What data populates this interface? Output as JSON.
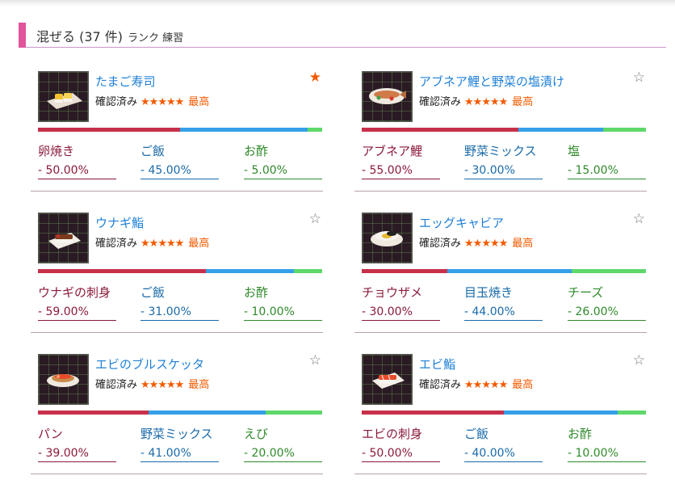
{
  "header": {
    "title": "混ぜる (37 件)",
    "subtitle": "ランク 練習"
  },
  "colors": {
    "accent": "#e0559b",
    "link": "#1e7fd6",
    "star": "#f25a00",
    "bar1": "#c8304a",
    "bar2": "#35a0e8",
    "bar3": "#5fd86a"
  },
  "recipes": [
    {
      "name": "たまご寿司",
      "status": "確認済み",
      "stars": "★★★★★",
      "grade": "最高",
      "favorite": true,
      "fav_icon": "★",
      "ingredients": [
        {
          "name": "卵焼き",
          "pct": "- 50.00%",
          "share": 50
        },
        {
          "name": "ご飯",
          "pct": "- 45.00%",
          "share": 45
        },
        {
          "name": "お酢",
          "pct": "- 5.00%",
          "share": 5
        }
      ]
    },
    {
      "name": "アブネア鯉と野菜の塩漬け",
      "status": "確認済み",
      "stars": "★★★★★",
      "grade": "最高",
      "favorite": false,
      "fav_icon": "☆",
      "ingredients": [
        {
          "name": "アブネア鯉",
          "pct": "- 55.00%",
          "share": 55
        },
        {
          "name": "野菜ミックス",
          "pct": "- 30.00%",
          "share": 30
        },
        {
          "name": "塩",
          "pct": "- 15.00%",
          "share": 15
        }
      ]
    },
    {
      "name": "ウナギ鮨",
      "status": "確認済み",
      "stars": "★★★★★",
      "grade": "最高",
      "favorite": false,
      "fav_icon": "☆",
      "ingredients": [
        {
          "name": "ウナギの刺身",
          "pct": "- 59.00%",
          "share": 59
        },
        {
          "name": "ご飯",
          "pct": "- 31.00%",
          "share": 31
        },
        {
          "name": "お酢",
          "pct": "- 10.00%",
          "share": 10
        }
      ]
    },
    {
      "name": "エッグキャビア",
      "status": "確認済み",
      "stars": "★★★★★",
      "grade": "最高",
      "favorite": false,
      "fav_icon": "☆",
      "ingredients": [
        {
          "name": "チョウザメ",
          "pct": "- 30.00%",
          "share": 30
        },
        {
          "name": "目玉焼き",
          "pct": "- 44.00%",
          "share": 44
        },
        {
          "name": "チーズ",
          "pct": "- 26.00%",
          "share": 26
        }
      ]
    },
    {
      "name": "エビのブルスケッタ",
      "status": "確認済み",
      "stars": "★★★★★",
      "grade": "最高",
      "favorite": false,
      "fav_icon": "☆",
      "ingredients": [
        {
          "name": "パン",
          "pct": "- 39.00%",
          "share": 39
        },
        {
          "name": "野菜ミックス",
          "pct": "- 41.00%",
          "share": 41
        },
        {
          "name": "えび",
          "pct": "- 20.00%",
          "share": 20
        }
      ]
    },
    {
      "name": "エビ鮨",
      "status": "確認済み",
      "stars": "★★★★★",
      "grade": "最高",
      "favorite": false,
      "fav_icon": "☆",
      "ingredients": [
        {
          "name": "エビの刺身",
          "pct": "- 50.00%",
          "share": 50
        },
        {
          "name": "ご飯",
          "pct": "- 40.00%",
          "share": 40
        },
        {
          "name": "お酢",
          "pct": "- 10.00%",
          "share": 10
        }
      ]
    }
  ]
}
